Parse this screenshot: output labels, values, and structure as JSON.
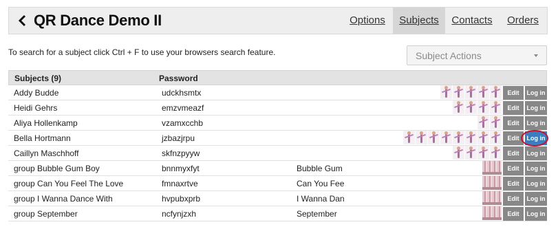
{
  "header": {
    "title": "QR Dance Demo II",
    "nav": [
      {
        "label": "Options"
      },
      {
        "label": "Subjects"
      },
      {
        "label": "Contacts"
      },
      {
        "label": "Orders"
      }
    ],
    "active_tab": "Subjects"
  },
  "hint": "To search for a subject click Ctrl + F to use your browsers search feature.",
  "subject_actions": {
    "label": "Subject Actions"
  },
  "table": {
    "columns": {
      "subjects": "Subjects (9)",
      "password": "Password"
    },
    "rows": [
      {
        "name": "Addy Budde",
        "password": "udckhsmtx",
        "dance": "",
        "thumbs": 5,
        "group": false
      },
      {
        "name": "Heidi Gehrs",
        "password": "emzvmeazf",
        "dance": "",
        "thumbs": 4,
        "group": false
      },
      {
        "name": "Aliya Hollenkamp",
        "password": "vzamxcchb",
        "dance": "",
        "thumbs": 2,
        "group": false
      },
      {
        "name": "Bella Hortmann",
        "password": "jzbazjrpu",
        "dance": "",
        "thumbs": 8,
        "group": false
      },
      {
        "name": "Caillyn Maschhoff",
        "password": "skfnzpyyw",
        "dance": "",
        "thumbs": 4,
        "group": false
      },
      {
        "name": "group Bubble Gum Boy",
        "password": "bnnmyxfyt",
        "dance": "Bubble Gum",
        "thumbs": 1,
        "group": true
      },
      {
        "name": "group Can You Feel The Love",
        "password": "fmnaxrtve",
        "dance": "Can You Fee",
        "thumbs": 1,
        "group": true
      },
      {
        "name": "group I Wanna Dance With",
        "password": "hvpubxprb",
        "dance": "I Wanna Dan",
        "thumbs": 1,
        "group": true
      },
      {
        "name": "group September",
        "password": "ncfynjzxh",
        "dance": "September",
        "thumbs": 1,
        "group": true
      }
    ],
    "edit_label": "Edit",
    "login_label": "Log in",
    "highlighted_row": 3
  },
  "colors": {
    "login_active": "#3b7dbd",
    "highlight_ring": "#c8102e",
    "button_gray": "#888888"
  }
}
